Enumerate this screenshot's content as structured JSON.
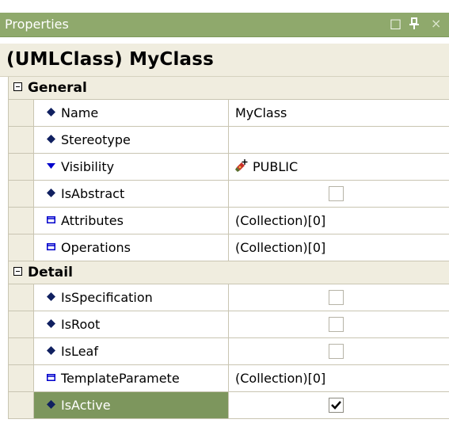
{
  "window": {
    "title": "Properties",
    "maximize_glyph": "□",
    "pin_glyph": "ᅟ⊥",
    "close_glyph": "×"
  },
  "object_title": "(UMLClass) MyClass",
  "categories": [
    {
      "label": "General",
      "properties": [
        {
          "label": "Name",
          "icon": "diamond-icon",
          "value": "MyClass",
          "kind": "text"
        },
        {
          "label": "Stereotype",
          "icon": "diamond-icon",
          "value": "",
          "kind": "text"
        },
        {
          "label": "Visibility",
          "icon": "dropdown-arrow-icon",
          "value": "PUBLIC",
          "kind": "visibility"
        },
        {
          "label": "IsAbstract",
          "icon": "diamond-icon",
          "value": false,
          "kind": "checkbox"
        },
        {
          "label": "Attributes",
          "icon": "collection-icon",
          "value": "(Collection)[0]",
          "kind": "text"
        },
        {
          "label": "Operations",
          "icon": "collection-icon",
          "value": "(Collection)[0]",
          "kind": "text"
        }
      ]
    },
    {
      "label": "Detail",
      "properties": [
        {
          "label": "IsSpecification",
          "icon": "diamond-icon",
          "value": false,
          "kind": "checkbox"
        },
        {
          "label": "IsRoot",
          "icon": "diamond-icon",
          "value": false,
          "kind": "checkbox"
        },
        {
          "label": "IsLeaf",
          "icon": "diamond-icon",
          "value": false,
          "kind": "checkbox"
        },
        {
          "label": "TemplateParamete",
          "icon": "collection-icon",
          "value": "(Collection)[0]",
          "kind": "text"
        },
        {
          "label": "IsActive",
          "icon": "diamond-icon",
          "value": true,
          "kind": "checkbox",
          "selected": true
        }
      ]
    }
  ],
  "colors": {
    "title_bar": "#8fa96c",
    "category_bg": "#f0eddf",
    "selection": "#7d965d",
    "diamond_icon": "#102060",
    "collection_icon": "#0000cc"
  }
}
